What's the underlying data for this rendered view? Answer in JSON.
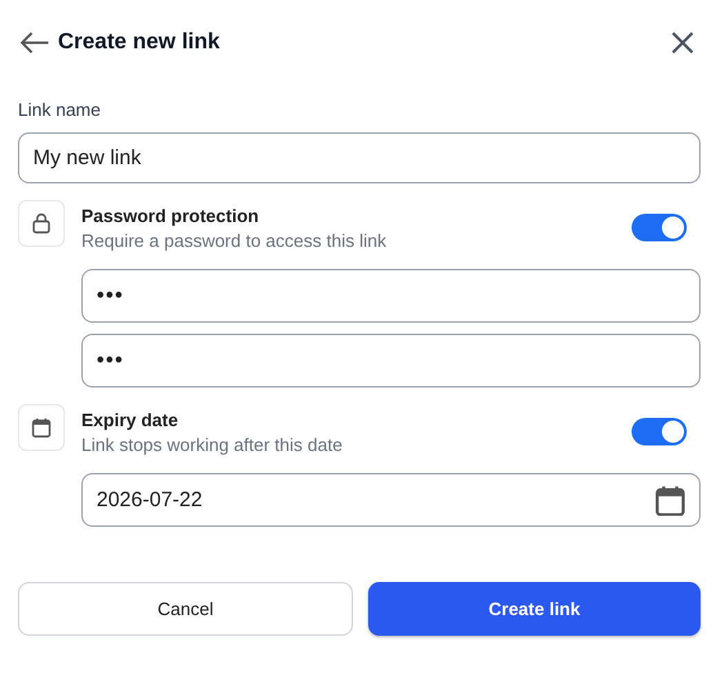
{
  "header": {
    "title": "Create new link"
  },
  "link_name": {
    "label": "Link name",
    "value": "My new link"
  },
  "sections": [
    {
      "kind": "password",
      "title": "Password protection",
      "description": "Require a password to access this link",
      "on": true,
      "fields": [
        {
          "kind": "secret",
          "value": "•••"
        },
        {
          "kind": "secret",
          "value": "•••"
        }
      ]
    },
    {
      "kind": "expiry",
      "title": "Expiry date",
      "description": "Link stops working after this date",
      "on": true,
      "fields": [
        {
          "kind": "date",
          "value": "2026-07-22"
        }
      ]
    }
  ],
  "buttons": [
    {
      "kind": "secondary",
      "label": "Cancel"
    },
    {
      "kind": "primary",
      "label": "Create link"
    }
  ]
}
